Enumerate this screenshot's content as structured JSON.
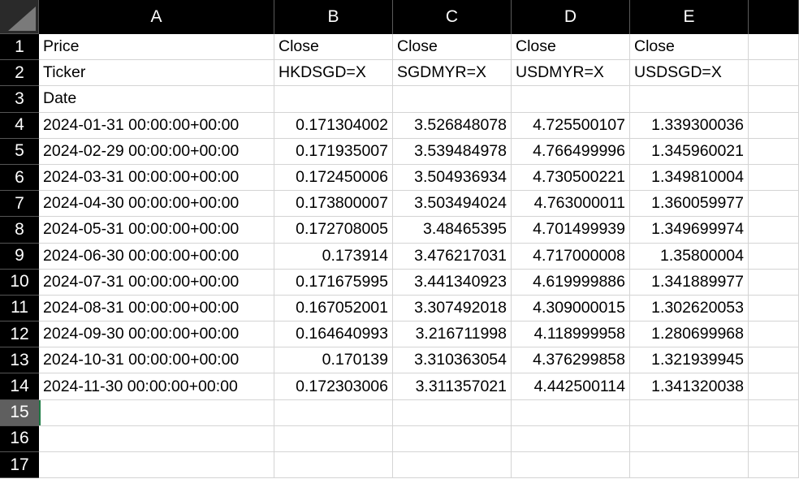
{
  "columns": [
    "A",
    "B",
    "C",
    "D",
    "E",
    ""
  ],
  "rows": [
    {
      "num": "1",
      "cells": [
        "Price",
        "Close",
        "Close",
        "Close",
        "Close",
        ""
      ],
      "numeric": false
    },
    {
      "num": "2",
      "cells": [
        "Ticker",
        "HKDSGD=X",
        "SGDMYR=X",
        "USDMYR=X",
        "USDSGD=X",
        ""
      ],
      "numeric": false
    },
    {
      "num": "3",
      "cells": [
        "Date",
        "",
        "",
        "",
        "",
        ""
      ],
      "numeric": false
    },
    {
      "num": "4",
      "cells": [
        "2024-01-31 00:00:00+00:00",
        "0.171304002",
        "3.526848078",
        "4.725500107",
        "1.339300036",
        ""
      ],
      "numeric": true
    },
    {
      "num": "5",
      "cells": [
        "2024-02-29 00:00:00+00:00",
        "0.171935007",
        "3.539484978",
        "4.766499996",
        "1.345960021",
        ""
      ],
      "numeric": true
    },
    {
      "num": "6",
      "cells": [
        "2024-03-31 00:00:00+00:00",
        "0.172450006",
        "3.504936934",
        "4.730500221",
        "1.349810004",
        ""
      ],
      "numeric": true
    },
    {
      "num": "7",
      "cells": [
        "2024-04-30 00:00:00+00:00",
        "0.173800007",
        "3.503494024",
        "4.763000011",
        "1.360059977",
        ""
      ],
      "numeric": true
    },
    {
      "num": "8",
      "cells": [
        "2024-05-31 00:00:00+00:00",
        "0.172708005",
        "3.48465395",
        "4.701499939",
        "1.349699974",
        ""
      ],
      "numeric": true
    },
    {
      "num": "9",
      "cells": [
        "2024-06-30 00:00:00+00:00",
        "0.173914",
        "3.476217031",
        "4.717000008",
        "1.35800004",
        ""
      ],
      "numeric": true
    },
    {
      "num": "10",
      "cells": [
        "2024-07-31 00:00:00+00:00",
        "0.171675995",
        "3.441340923",
        "4.619999886",
        "1.341889977",
        ""
      ],
      "numeric": true
    },
    {
      "num": "11",
      "cells": [
        "2024-08-31 00:00:00+00:00",
        "0.167052001",
        "3.307492018",
        "4.309000015",
        "1.302620053",
        ""
      ],
      "numeric": true
    },
    {
      "num": "12",
      "cells": [
        "2024-09-30 00:00:00+00:00",
        "0.164640993",
        "3.216711998",
        "4.118999958",
        "1.280699968",
        ""
      ],
      "numeric": true
    },
    {
      "num": "13",
      "cells": [
        "2024-10-31 00:00:00+00:00",
        "0.170139",
        "3.310363054",
        "4.376299858",
        "1.321939945",
        ""
      ],
      "numeric": true
    },
    {
      "num": "14",
      "cells": [
        "2024-11-30 00:00:00+00:00",
        "0.172303006",
        "3.311357021",
        "4.442500114",
        "1.341320038",
        ""
      ],
      "numeric": true
    },
    {
      "num": "15",
      "cells": [
        "",
        "",
        "",
        "",
        "",
        ""
      ],
      "numeric": false
    },
    {
      "num": "16",
      "cells": [
        "",
        "",
        "",
        "",
        "",
        ""
      ],
      "numeric": false
    },
    {
      "num": "17",
      "cells": [
        "",
        "",
        "",
        "",
        "",
        ""
      ],
      "numeric": false
    }
  ],
  "active_row": "15",
  "colors": {
    "header_bg": "#000000",
    "active_row_bg": "#5f5f5f",
    "selection": "#1d7a44",
    "gridline": "#d4d4d4"
  }
}
